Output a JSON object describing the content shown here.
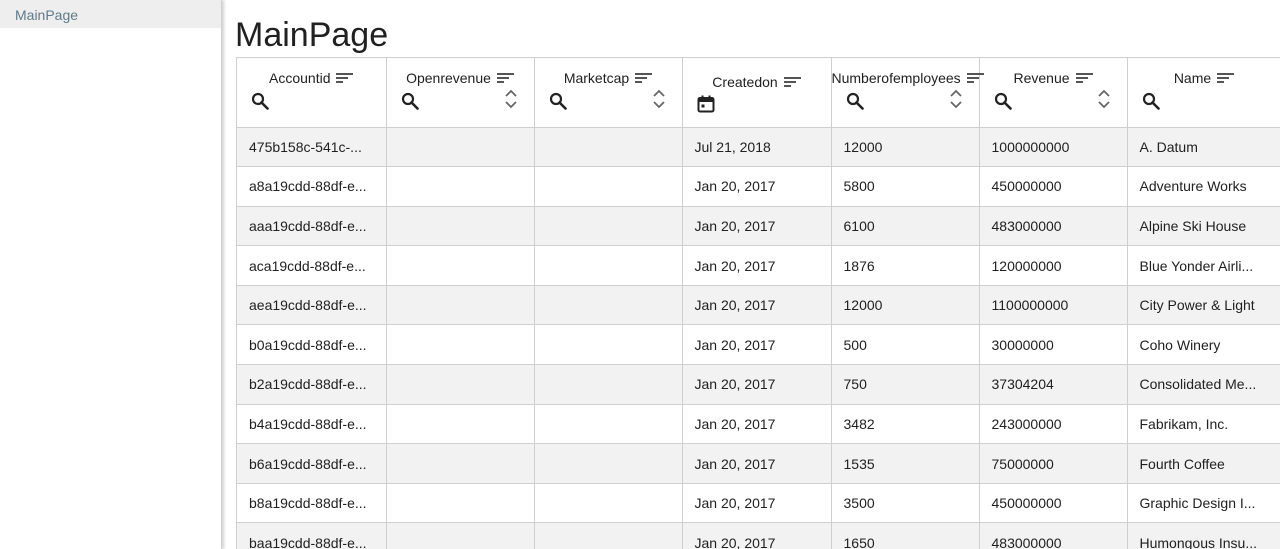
{
  "sidebar": {
    "items": [
      {
        "label": "MainPage"
      }
    ]
  },
  "page": {
    "title": "MainPage"
  },
  "table": {
    "columns": [
      {
        "label": "Accountid",
        "filter": "search"
      },
      {
        "label": "Openrevenue",
        "filter": "search",
        "numeric": true
      },
      {
        "label": "Marketcap",
        "filter": "search",
        "numeric": true
      },
      {
        "label": "Createdon",
        "filter": "calendar"
      },
      {
        "label": "Numberofemployees",
        "filter": "search",
        "numeric": true
      },
      {
        "label": "Revenue",
        "filter": "search",
        "numeric": true
      },
      {
        "label": "Name",
        "filter": "search"
      }
    ],
    "rows": [
      [
        "475b158c-541c-...",
        "",
        "",
        "Jul 21, 2018",
        "12000",
        "1000000000",
        "A. Datum"
      ],
      [
        "a8a19cdd-88df-e...",
        "",
        "",
        "Jan 20, 2017",
        "5800",
        "450000000",
        "Adventure Works"
      ],
      [
        "aaa19cdd-88df-e...",
        "",
        "",
        "Jan 20, 2017",
        "6100",
        "483000000",
        "Alpine Ski House"
      ],
      [
        "aca19cdd-88df-e...",
        "",
        "",
        "Jan 20, 2017",
        "1876",
        "120000000",
        "Blue Yonder Airli..."
      ],
      [
        "aea19cdd-88df-e...",
        "",
        "",
        "Jan 20, 2017",
        "12000",
        "1100000000",
        "City Power & Light"
      ],
      [
        "b0a19cdd-88df-e...",
        "",
        "",
        "Jan 20, 2017",
        "500",
        "30000000",
        "Coho Winery"
      ],
      [
        "b2a19cdd-88df-e...",
        "",
        "",
        "Jan 20, 2017",
        "750",
        "37304204",
        "Consolidated Me..."
      ],
      [
        "b4a19cdd-88df-e...",
        "",
        "",
        "Jan 20, 2017",
        "3482",
        "243000000",
        "Fabrikam, Inc."
      ],
      [
        "b6a19cdd-88df-e...",
        "",
        "",
        "Jan 20, 2017",
        "1535",
        "75000000",
        "Fourth Coffee"
      ],
      [
        "b8a19cdd-88df-e...",
        "",
        "",
        "Jan 20, 2017",
        "3500",
        "450000000",
        "Graphic Design I..."
      ],
      [
        "baa19cdd-88df-e...",
        "",
        "",
        "Jan 20, 2017",
        "1650",
        "483000000",
        "Humongous Insu..."
      ]
    ]
  }
}
